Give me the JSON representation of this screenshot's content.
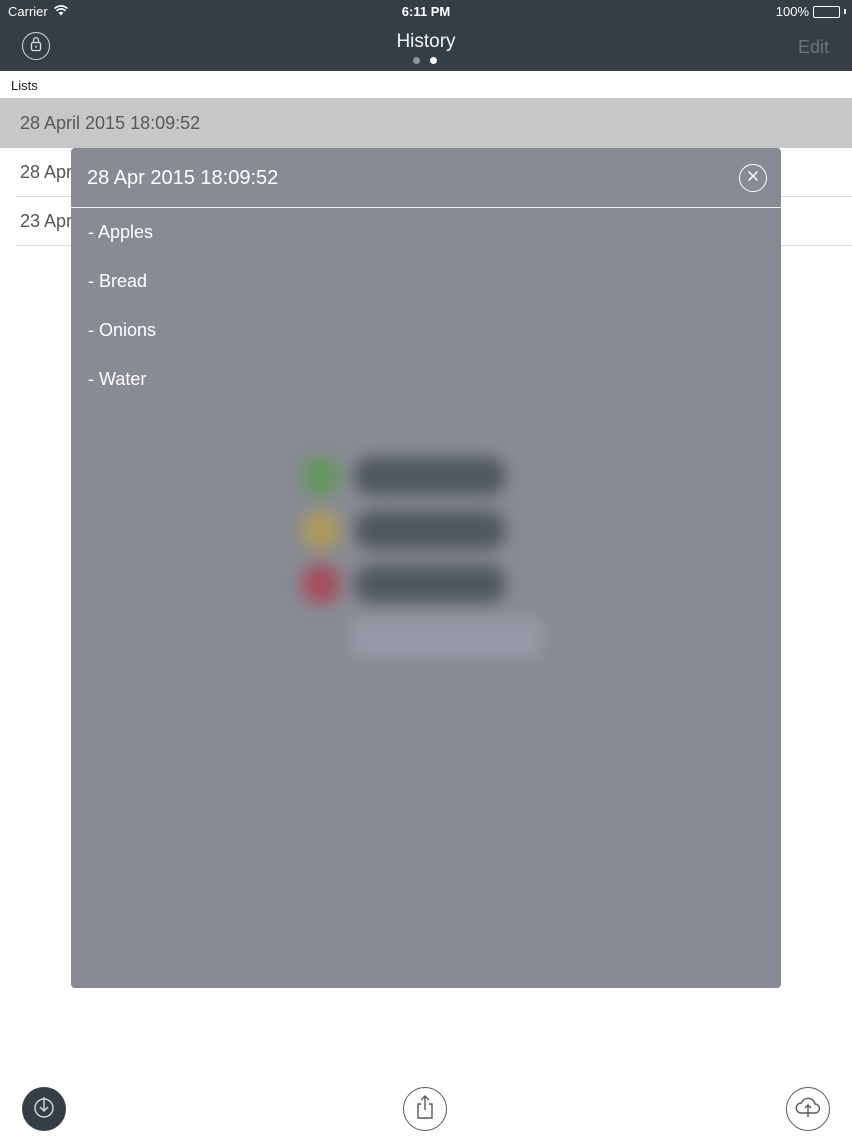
{
  "status_bar": {
    "carrier": "Carrier",
    "time": "6:11 PM",
    "battery": "100%",
    "icons": {
      "wifi": "wifi-icon",
      "battery": "battery-icon"
    }
  },
  "nav": {
    "title": "History",
    "edit_label": "Edit",
    "left_icon": "lock-icon",
    "page_count": 2,
    "active_page": 2
  },
  "section": {
    "header": "Lists"
  },
  "history_rows": [
    {
      "label": "28 April 2015 18:09:52",
      "selected": true
    },
    {
      "label": "28 Apr",
      "selected": false
    },
    {
      "label": "23 Apr",
      "selected": false
    }
  ],
  "popup": {
    "title": "28 Apr 2015 18:09:52",
    "close_icon": "close-icon",
    "items": [
      "- Apples",
      "- Bread",
      "- Onions",
      "- Water"
    ]
  },
  "toolbar": {
    "import_icon": "import-icon",
    "share_icon": "share-icon",
    "cloud_icon": "cloud-upload-icon"
  },
  "colors": {
    "nav_bg": "#353d45",
    "selected_row": "#c5c7c9",
    "popup_bg": "#888b93",
    "dot_green": "#5a9a4f",
    "dot_yellow": "#b8a04a",
    "dot_red": "#b03a4a"
  }
}
